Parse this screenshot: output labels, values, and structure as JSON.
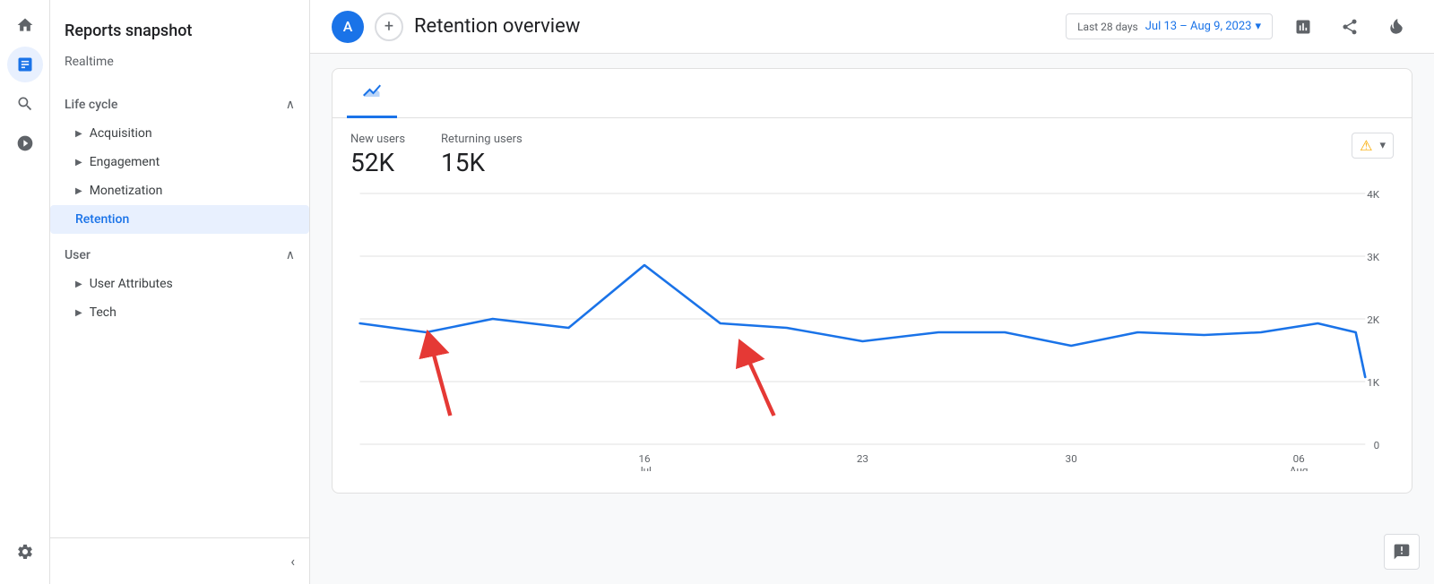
{
  "iconRail": {
    "items": [
      {
        "name": "home-icon",
        "icon": "⌂",
        "active": false
      },
      {
        "name": "analytics-icon",
        "icon": "📊",
        "active": true
      },
      {
        "name": "search-icon",
        "icon": "🔍",
        "active": false
      },
      {
        "name": "wifi-icon",
        "icon": "📡",
        "active": false
      }
    ],
    "bottomItems": [
      {
        "name": "settings-icon",
        "icon": "⚙"
      }
    ]
  },
  "sidebar": {
    "title": "Reports snapshot",
    "realtime": "Realtime",
    "sections": [
      {
        "name": "Life cycle",
        "items": [
          {
            "label": "Acquisition",
            "active": false
          },
          {
            "label": "Engagement",
            "active": false
          },
          {
            "label": "Monetization",
            "active": false
          },
          {
            "label": "Retention",
            "active": true
          }
        ]
      },
      {
        "name": "User",
        "items": [
          {
            "label": "User Attributes",
            "active": false
          },
          {
            "label": "Tech",
            "active": false
          }
        ]
      }
    ],
    "collapse_label": "‹"
  },
  "topbar": {
    "avatar": "A",
    "add_btn": "+",
    "page_title": "Retention overview",
    "date_prefix": "Last 28 days",
    "date_range": "Jul 13 – Aug 9, 2023",
    "dropdown_icon": "▾"
  },
  "chart": {
    "tabs": [
      {
        "label": "",
        "active": true
      }
    ],
    "metrics": [
      {
        "label": "New users",
        "value": "52K"
      },
      {
        "label": "Returning users",
        "value": "15K"
      }
    ],
    "warning_btn": "▾",
    "xaxis": {
      "labels": [
        {
          "text": "16",
          "sub": "Jul"
        },
        {
          "text": "23",
          "sub": ""
        },
        {
          "text": "30",
          "sub": ""
        },
        {
          "text": "06",
          "sub": "Aug"
        }
      ]
    },
    "yaxis": {
      "labels": [
        "4K",
        "3K",
        "2K",
        "1K",
        "0"
      ]
    },
    "line_color": "#1a73e8",
    "colors": {
      "accent": "#1a73e8",
      "warning": "#f9ab00"
    }
  }
}
